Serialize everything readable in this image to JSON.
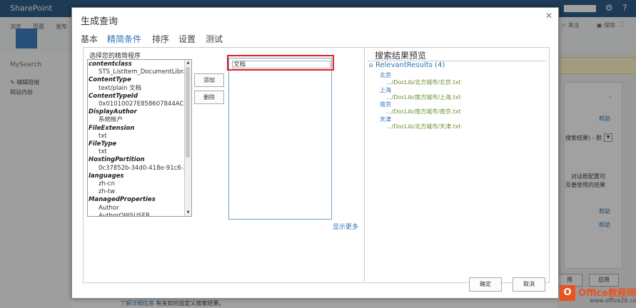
{
  "sharepoint": {
    "brand": "SharePoint",
    "ribbon_tabs": [
      "浏览",
      "页面",
      "发布"
    ],
    "nav_mysearch": "MySearch",
    "nav_edit_links": "编辑链接",
    "nav_site_content": "网站内容",
    "follow": "关注",
    "save": "保存",
    "help_links": [
      "帮助",
      "帮助",
      "帮助"
    ],
    "results_text": "搜索结果) - 默",
    "note_line1": "对话框配置可",
    "note_line2": "及要使用的结果",
    "apply": "应用",
    "apply_partial": "用",
    "footer_link": "了解详细信息",
    "footer_text": "有关如何自定义搜索结果。"
  },
  "watermark": {
    "title": "Office教程网",
    "url": "www.office26.com"
  },
  "dialog": {
    "title": "生成查询",
    "tabs": [
      "基本",
      "精简条件",
      "排序",
      "设置",
      "测试"
    ],
    "active_tab": "精简条件",
    "select_label": "选择您的精简程序",
    "refiners": [
      {
        "text": "contentclass",
        "level": "header"
      },
      {
        "text": "STS_ListItem_DocumentLibra",
        "level": "sub"
      },
      {
        "text": "ContentType",
        "level": "header"
      },
      {
        "text": "text/plain 文档",
        "level": "sub"
      },
      {
        "text": "ContentTypeId",
        "level": "header"
      },
      {
        "text": "0x01010027E858607844AC4",
        "level": "sub"
      },
      {
        "text": "DisplayAuthor",
        "level": "header"
      },
      {
        "text": "系统帐户",
        "level": "sub"
      },
      {
        "text": "FileExtension",
        "level": "header"
      },
      {
        "text": "txt",
        "level": "sub"
      },
      {
        "text": "FileType",
        "level": "header"
      },
      {
        "text": "txt",
        "level": "sub"
      },
      {
        "text": "HostingPartition",
        "level": "header"
      },
      {
        "text": "0c37852b-34d0-418e-91c6-2",
        "level": "sub"
      },
      {
        "text": "languages",
        "level": "header"
      },
      {
        "text": "zh-cn",
        "level": "sub"
      },
      {
        "text": "zh-tw",
        "level": "sub"
      },
      {
        "text": "ManagedProperties",
        "level": "header"
      },
      {
        "text": "Author",
        "level": "sub"
      },
      {
        "text": "AuthorOWSUSER",
        "level": "sub"
      }
    ],
    "add_button": "添加",
    "remove_button": "删除",
    "selected_refiner": "文档",
    "show_more": "显示更多",
    "preview_title": "搜索结果预览",
    "relevant_results_label": "RelevantResults (4)",
    "results": [
      {
        "title": "北京",
        "url": ".../DocLib/北方城市/北京.txt"
      },
      {
        "title": "上海",
        "url": ".../DocLib/南方城市/上海.txt"
      },
      {
        "title": "南京",
        "url": ".../DocLib/南方城市/南京.txt"
      },
      {
        "title": "天津",
        "url": ".../DocLib/北方城市/天津.txt"
      }
    ],
    "ok_button": "确定",
    "cancel_button": "取消"
  }
}
